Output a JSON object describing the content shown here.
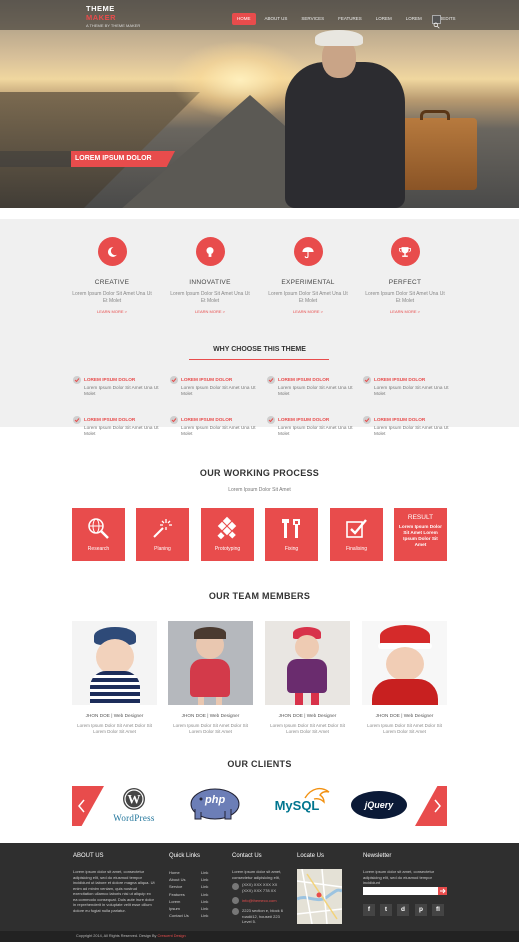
{
  "header": {
    "logo_line1": "THEME",
    "logo_line2": "MAKER",
    "tagline": "A THEME BY THEME MAKER",
    "nav": [
      "HOME",
      "ABOUT US",
      "SERVICES",
      "FEATURES",
      "LOREM",
      "LOREM",
      "CREDITS"
    ],
    "active_nav": "HOME"
  },
  "hero": {
    "caption": "LOREM IPSUM DOLOR"
  },
  "features": [
    {
      "title": "CREATIVE",
      "icon": "moon-icon",
      "desc": "Lorem Ipsum Dolor Sit Amet Una Ut Et Molet",
      "more": "LEARN MORE >"
    },
    {
      "title": "INNOVATIVE",
      "icon": "lightbulb-icon",
      "desc": "Lorem Ipsum Dolor Sit Amet Una Ut Et Molet",
      "more": "LEARN MORE >"
    },
    {
      "title": "EXPERIMENTAL",
      "icon": "umbrella-icon",
      "desc": "Lorem Ipsum Dolor Sit Amet Una Ut Et Molet",
      "more": "LEARN MORE >"
    },
    {
      "title": "PERFECT",
      "icon": "trophy-icon",
      "desc": "Lorem Ipsum Dolor Sit Amet Una Ut Et Molet",
      "more": "LEARN MORE >"
    }
  ],
  "why": {
    "title": "WHY CHOOSE THIS THEME",
    "items": [
      {
        "heading": "LOREM IPSUM DOLOR",
        "text": "Lorem Ipsum Dolor Sit Amet Una Ut Molet"
      },
      {
        "heading": "LOREM IPSUM DOLOR",
        "text": "Lorem Ipsum Dolor Sit Amet Una Ut Molet"
      },
      {
        "heading": "LOREM IPSUM DOLOR",
        "text": "Lorem Ipsum Dolor Sit Amet Una Ut Molet"
      },
      {
        "heading": "LOREM IPSUM DOLOR",
        "text": "Lorem Ipsum Dolor Sit Amet Una Ut Molet"
      },
      {
        "heading": "LOREM IPSUM DOLOR",
        "text": "Lorem Ipsum Dolor Sit Amet Una Ut Molet"
      },
      {
        "heading": "LOREM IPSUM DOLOR",
        "text": "Lorem Ipsum Dolor Sit Amet Una Ut Molet"
      },
      {
        "heading": "LOREM IPSUM DOLOR",
        "text": "Lorem Ipsum Dolor Sit Amet Una Ut Molet"
      },
      {
        "heading": "LOREM IPSUM DOLOR",
        "text": "Lorem Ipsum Dolor Sit Amet Una Ut Molet"
      }
    ]
  },
  "process": {
    "title": "OUR WORKING PROCESS",
    "subtitle": "Lorem Ipsum Dolor Sit Amet",
    "steps": [
      "Research",
      "Planing",
      "Prototyping",
      "Fixing",
      "Finalising"
    ],
    "result_title": "RESULT",
    "result_text": "Lorem Ipsum Dolor Sit Amet Lorem Ipsum Dolor Sit Amet"
  },
  "team": {
    "title": "OUR TEAM MEMBERS",
    "members": [
      {
        "name": "JHON DOE",
        "role": "Web Designer",
        "bio": "Lorem Ipsum Dolor Sit Amet Dolor Sit Lorem Dolor Sit Amet"
      },
      {
        "name": "JHON DOE",
        "role": "Web Designer",
        "bio": "Lorem Ipsum Dolor Sit Amet Dolor Sit Lorem Dolor Sit Amet"
      },
      {
        "name": "JHON DOE",
        "role": "Web Designer",
        "bio": "Lorem Ipsum Dolor Sit Amet Dolor Sit Lorem Dolor Sit Amet"
      },
      {
        "name": "JHON DOE",
        "role": "Web Designer",
        "bio": "Lorem Ipsum Dolor Sit Amet Dolor Sit Lorem Dolor Sit Amet"
      }
    ]
  },
  "clients": {
    "title": "OUR CLIENTS",
    "logos": [
      "WordPress",
      "php",
      "MySQL",
      "jQuery"
    ]
  },
  "footer": {
    "about_title": "ABOUT US",
    "about_text": "Lorem ipsum dolor sit amet, consectetur adipisicing elit, sed do eiusmod tempor incididunt ut labore et dolore magna aliqua. Ut enim ad minim veniam, quis nostrud exercitation ullamco laboris nisi ut aliquip ex ea commodo consequat. Duis aute irure dolor in reprehenderit in voluptate velit esse cillum dolore eu fugiat nulla pariatur.",
    "quick_title": "Quick Links",
    "quick_links": [
      "Home",
      "About Us",
      "Service",
      "Features",
      "Lorem",
      "Ipsum",
      "Contact Us"
    ],
    "link_label": "Link",
    "contact_title": "Contact Us",
    "contact_text": "Lorem ipsum dolor sit amet, consectetur adipisicing elit,",
    "phone": "(XXX) XXX XXX XX\n(XXX) XXX 778 XX",
    "email": "info@themeco.com",
    "address": "2223 section e, block 6 road#12, house# 223 Level 5.",
    "locate_title": "Locate Us",
    "newsletter_title": "Newsletter",
    "newsletter_text": "Lorem ipsum dolor sit amet, consectetur adipisicing elit, sed do eiusmod tempor incididunt",
    "social": [
      "f",
      "t",
      "d",
      "p",
      "fl"
    ],
    "copyright": "Copyright 2014, All Rights Reserved. Design By",
    "designer": "Crescent Design"
  },
  "colors": {
    "accent": "#e84c4c",
    "footer": "#2f2f2f",
    "band": "#f0f0f0"
  }
}
